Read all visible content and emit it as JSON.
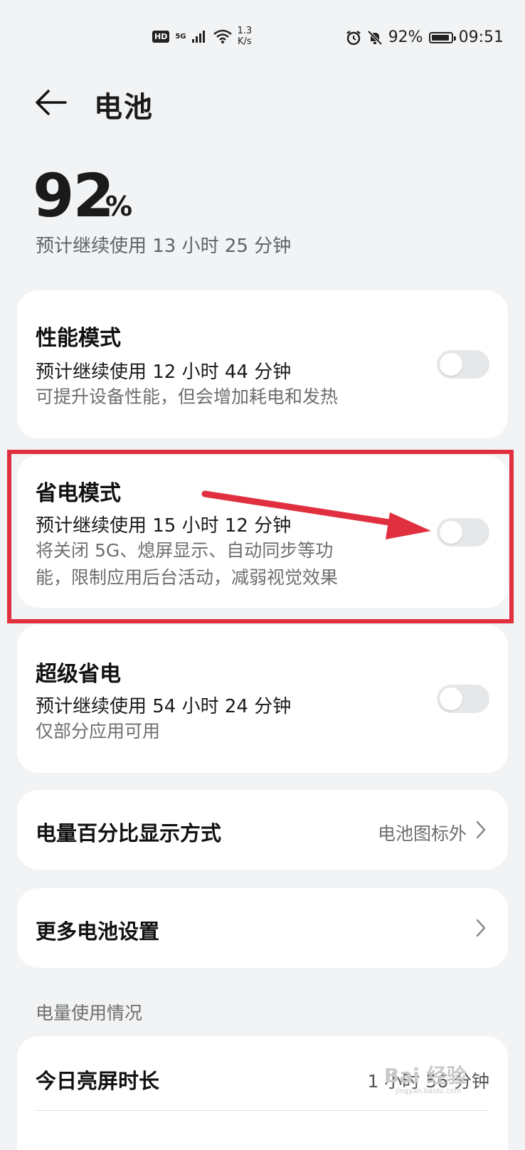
{
  "status_bar": {
    "hd": "HD",
    "network": "5G",
    "speed_value": "1.3",
    "speed_unit": "K/s",
    "battery_pct": "92%",
    "battery_level": 0.92,
    "time": "09:51",
    "icons": [
      "signal-icon",
      "wifi-icon",
      "alarm-icon",
      "mute-icon",
      "battery-icon"
    ]
  },
  "header": {
    "title": "电池",
    "back_icon": "back-arrow-icon"
  },
  "battery": {
    "percent": "92",
    "percent_sign": "%",
    "remaining": "预计继续使用 13 小时 25 分钟"
  },
  "modes": [
    {
      "title": "性能模式",
      "estimate": "预计继续使用 12 小时 44 分钟",
      "desc_line1": "可提升设备性能，但会增加耗电和发热",
      "enabled": false
    },
    {
      "title": "省电模式",
      "estimate": "预计继续使用 15 小时 12 分钟",
      "desc_line1": "将关闭 5G、熄屏显示、自动同步等功",
      "desc_line2": "能，限制应用后台活动，减弱视觉效果",
      "enabled": false
    },
    {
      "title": "超级省电",
      "estimate": "预计继续使用 54 小时 24 分钟",
      "desc_line1": "仅部分应用可用",
      "enabled": false
    }
  ],
  "settings": {
    "percent_display_label": "电量百分比显示方式",
    "percent_display_value": "电池图标外",
    "more_settings_label": "更多电池设置"
  },
  "usage": {
    "section_label": "电量使用情况",
    "screen_time_label": "今日亮屏时长",
    "screen_time_value": "1 小时 56 分钟"
  },
  "annotation": {
    "highlight_color": "#e0303f"
  },
  "watermark": {
    "text": "Bai 经验",
    "sub": "jingyan.baidu.com"
  }
}
